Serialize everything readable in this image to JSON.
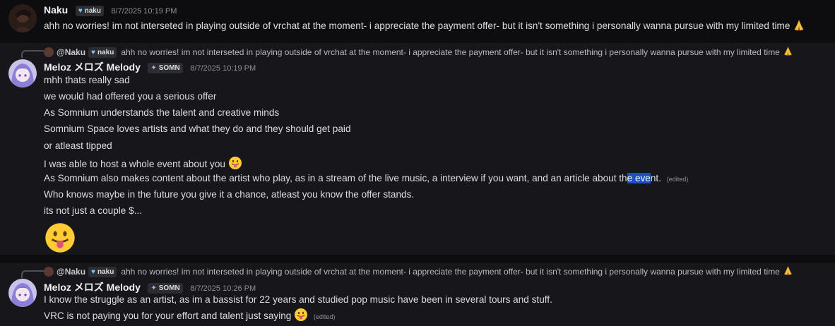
{
  "messages": [
    {
      "author": "Naku",
      "tag": "naku",
      "timestamp": "8/7/2025 10:19 PM",
      "lines": [
        "ahh no worries! im not interseted in playing outside of vrchat at the moment- i appreciate the payment offer- but it isn't something i personally wanna pursue with my limited time"
      ]
    },
    {
      "reply": {
        "author": "@Naku",
        "tag": "naku",
        "text": "ahh no worries! im not interseted in playing outside of vrchat at the moment- i appreciate the payment offer- but it isn't something i personally wanna pursue with my limited time"
      },
      "author": "Meloz メロズ Melody",
      "tag": "SOMN",
      "timestamp": "8/7/2025 10:19 PM",
      "lines": [
        "mhh thats really sad",
        "we would had offered you a serious offer",
        "As Somnium understands the talent and creative minds",
        "Somnium Space loves artists and what they do and they should get paid",
        "or atleast tipped",
        "I was able to host a whole event about you",
        "As Somnium also makes content about the artist who play, as in a stream of the live music, a interview if you want, and an article about th",
        "e eve",
        "nt.",
        "Who knows maybe in the future you give it a chance, atleast you know the offer stands.",
        "its not just a couple $..."
      ],
      "edited": "(edited)"
    },
    {
      "reply": {
        "author": "@Naku",
        "tag": "naku",
        "text": "ahh no worries! im not interseted in playing outside of vrchat at the moment- i appreciate the payment offer- but it isn't something i personally wanna pursue with my limited time"
      },
      "author": "Meloz メロズ Melody",
      "tag": "SOMN",
      "timestamp": "8/7/2025 10:26 PM",
      "lines": [
        "I know the struggle as an artist, as im a bassist for 22 years and studied pop music have been in several tours and stuff.",
        "VRC is not paying you for your effort and talent just saying"
      ],
      "edited": "(edited)"
    }
  ]
}
